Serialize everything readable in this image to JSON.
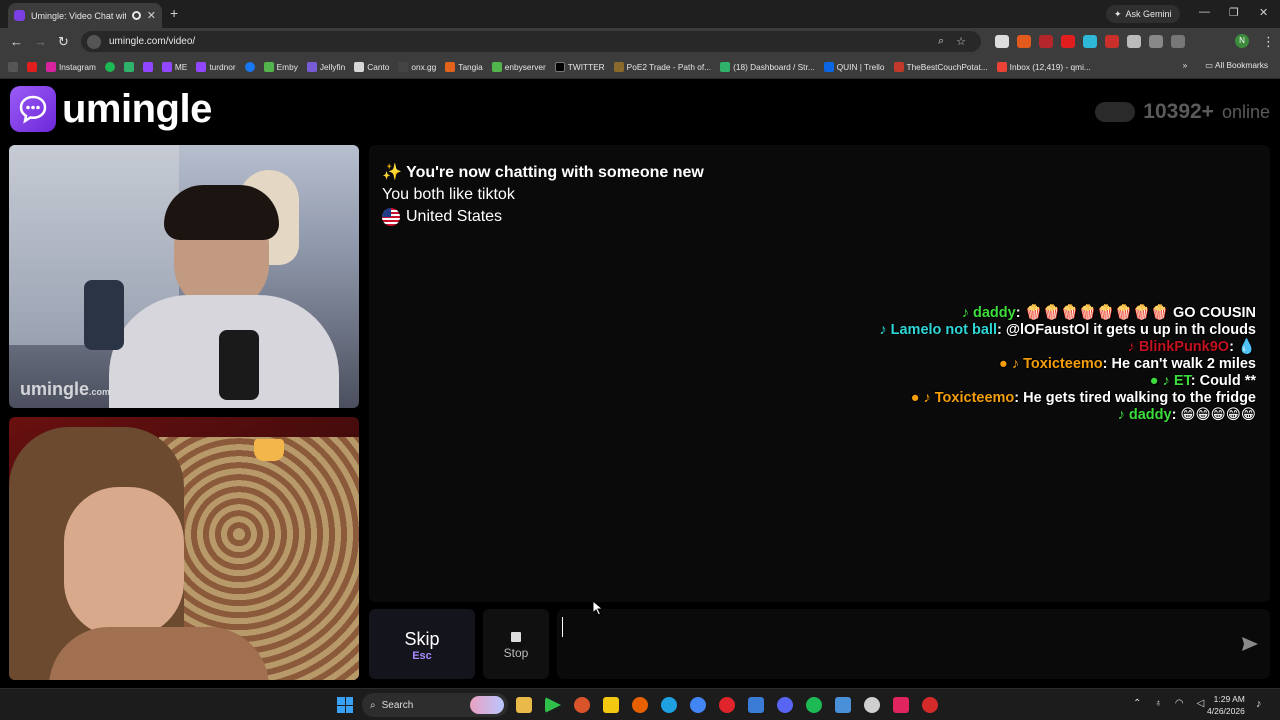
{
  "browser": {
    "tab_title": "Umingle: Video Chat with S",
    "new_tab": "+",
    "ask_gemini": "Ask Gemini",
    "url": "umingle.com/video/",
    "bookmarks": [
      "Instagram",
      "ME",
      "turdnor",
      "Emby",
      "Jellyfin",
      "Canto",
      "onx.gg",
      "Tangia",
      "enbyserver",
      "TWITTER",
      "PoE2 Trade - Path of...",
      "(18) Dashboard / Str...",
      "QUIN | Trello",
      "TheBestCouchPotat...",
      "Inbox (12,419) - qmi..."
    ],
    "all_bookmarks": "All Bookmarks",
    "profile_initial": "N"
  },
  "site": {
    "logo_text": "umingle",
    "online_count": "10392+",
    "online_label": "online",
    "watermark": "umingle",
    "watermark_suffix": ".com"
  },
  "chat": {
    "system_new": "✨ You're now chatting with someone new",
    "common_interest": "You both like tiktok",
    "country": "United States"
  },
  "overlay_messages": [
    {
      "user": "daddy",
      "user_color": "#3ddc3d",
      "prefix": "♪ ",
      "text": ": 🍿🍿🍿🍿🍿🍿🍿🍿 GO COUSIN",
      "text_color": "#ffffff"
    },
    {
      "user": "Lamelo not ball",
      "user_color": "#2fd6d6",
      "prefix": "♪ ",
      "text": ": @lOFaustOl it gets u up in th clouds",
      "text_color": "#ffffff"
    },
    {
      "user": "BlinkPunk9O",
      "user_color": "#c1121f",
      "prefix": "♪ ",
      "text": ": 💧",
      "text_color": "#ffffff"
    },
    {
      "user": "Toxicteemo",
      "user_color": "#f59e0b",
      "prefix": "● ♪ ",
      "text": ": He can't walk 2 miles",
      "text_color": "#ffffff"
    },
    {
      "user": "ET",
      "user_color": "#3ddc3d",
      "prefix": "● ♪ ",
      "text": ": Could **",
      "text_color": "#ffffff"
    },
    {
      "user": "Toxicteemo",
      "user_color": "#f59e0b",
      "prefix": "● ♪ ",
      "text": ": He gets tired walking to the fridge",
      "text_color": "#ffffff"
    },
    {
      "user": "daddy",
      "user_color": "#3ddc3d",
      "prefix": "♪ ",
      "text": ": 😁😁😁😁😁",
      "text_color": "#ffffff"
    }
  ],
  "controls": {
    "skip_label": "Skip",
    "skip_key": "Esc",
    "stop_label": "Stop",
    "message_value": ""
  },
  "taskbar": {
    "search_label": "Search",
    "time": "1:29 AM",
    "date": "4/26/2026"
  },
  "colors": {
    "accent": "#8b5cf6",
    "page_bg": "#000000",
    "chat_bg": "#0a0a0a"
  }
}
